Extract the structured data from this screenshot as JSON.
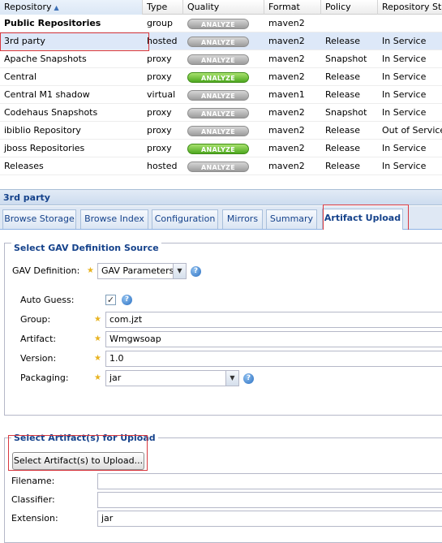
{
  "grid": {
    "columns": [
      "Repository",
      "Type",
      "Quality",
      "Format",
      "Policy",
      "Repository Stat"
    ],
    "rows": [
      {
        "name": "Public Repositories",
        "type": "group",
        "quality": "ANALYZE",
        "quality_color": "gray",
        "format": "maven2",
        "policy": "",
        "status": ""
      },
      {
        "name": "3rd party",
        "type": "hosted",
        "quality": "ANALYZE",
        "quality_color": "gray",
        "format": "maven2",
        "policy": "Release",
        "status": "In Service"
      },
      {
        "name": "Apache Snapshots",
        "type": "proxy",
        "quality": "ANALYZE",
        "quality_color": "gray",
        "format": "maven2",
        "policy": "Snapshot",
        "status": "In Service"
      },
      {
        "name": "Central",
        "type": "proxy",
        "quality": "ANALYZE",
        "quality_color": "green",
        "format": "maven2",
        "policy": "Release",
        "status": "In Service"
      },
      {
        "name": "Central M1 shadow",
        "type": "virtual",
        "quality": "ANALYZE",
        "quality_color": "gray",
        "format": "maven1",
        "policy": "Release",
        "status": "In Service"
      },
      {
        "name": "Codehaus Snapshots",
        "type": "proxy",
        "quality": "ANALYZE",
        "quality_color": "gray",
        "format": "maven2",
        "policy": "Snapshot",
        "status": "In Service"
      },
      {
        "name": "ibiblio Repository",
        "type": "proxy",
        "quality": "ANALYZE",
        "quality_color": "gray",
        "format": "maven2",
        "policy": "Release",
        "status": "Out of Service -"
      },
      {
        "name": "jboss Repositories",
        "type": "proxy",
        "quality": "ANALYZE",
        "quality_color": "green",
        "format": "maven2",
        "policy": "Release",
        "status": "In Service"
      },
      {
        "name": "Releases",
        "type": "hosted",
        "quality": "ANALYZE",
        "quality_color": "gray",
        "format": "maven2",
        "policy": "Release",
        "status": "In Service"
      }
    ]
  },
  "panel": {
    "title": "3rd party",
    "tabs": [
      "Browse Storage",
      "Browse Index",
      "Configuration",
      "Mirrors",
      "Summary",
      "Artifact Upload"
    ],
    "active_tab": "Artifact Upload"
  },
  "gav": {
    "legend": "Select GAV Definition Source",
    "definition_label": "GAV Definition:",
    "definition_value": "GAV Parameters",
    "auto_guess_label": "Auto Guess:",
    "auto_guess_checked": true,
    "group_label": "Group:",
    "group_value": "com.jzt",
    "artifact_label": "Artifact:",
    "artifact_value": "Wmgwsoap",
    "version_label": "Version:",
    "version_value": "1.0",
    "packaging_label": "Packaging:",
    "packaging_value": "jar"
  },
  "upload": {
    "legend": "Select Artifact(s) for Upload",
    "button_label": "Select Artifact(s) to Upload...",
    "filename_label": "Filename:",
    "filename_value": "",
    "classifier_label": "Classifier:",
    "classifier_value": "",
    "extension_label": "Extension:",
    "extension_value": "jar"
  },
  "icons": {
    "sort": "sort-ascending-icon",
    "help": "help-icon",
    "required": "required-star-icon",
    "dropdown": "dropdown-arrow-icon",
    "checkbox": "checkbox-checked-icon"
  },
  "colors": {
    "accent": "#15428b",
    "selection": "#dde8f8",
    "annotation": "#d9383f",
    "badge_green": "#4ea81f",
    "badge_gray": "#9c9c9c"
  }
}
